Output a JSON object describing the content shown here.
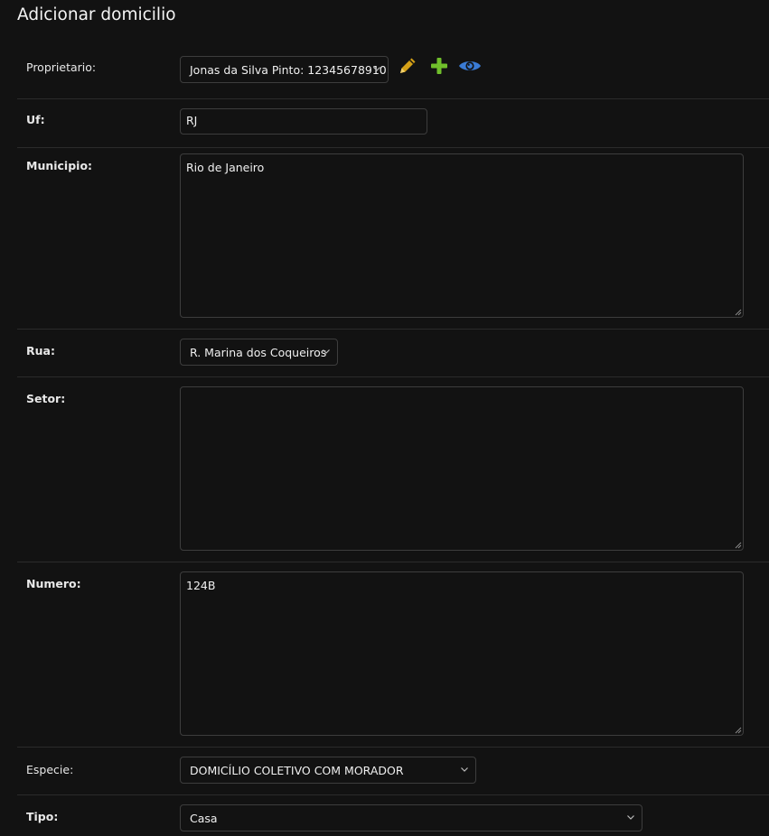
{
  "page": {
    "title": "Adicionar domicilio"
  },
  "fields": {
    "proprietario": {
      "label": "Proprietario:",
      "selected": "Jonas da Silva Pinto: 12345678910"
    },
    "uf": {
      "label": "Uf:",
      "value": "RJ"
    },
    "municipio": {
      "label": "Municipio:",
      "value": "Rio de Janeiro"
    },
    "rua": {
      "label": "Rua:",
      "selected": "R. Marina dos Coqueiros"
    },
    "setor": {
      "label": "Setor:",
      "value": ""
    },
    "numero": {
      "label": "Numero:",
      "value": "124B"
    },
    "especie": {
      "label": "Especie:",
      "selected": "DOMICÍLIO COLETIVO COM MORADOR"
    },
    "tipo": {
      "label": "Tipo:",
      "selected": "Casa"
    }
  },
  "icons": {
    "edit": "pencil-icon",
    "add": "plus-icon",
    "view": "eye-icon"
  },
  "colors": {
    "background": "#121212",
    "edit_icon": "#d4a017",
    "add_icon": "#70bf2b",
    "view_icon": "#3a7bd5"
  }
}
